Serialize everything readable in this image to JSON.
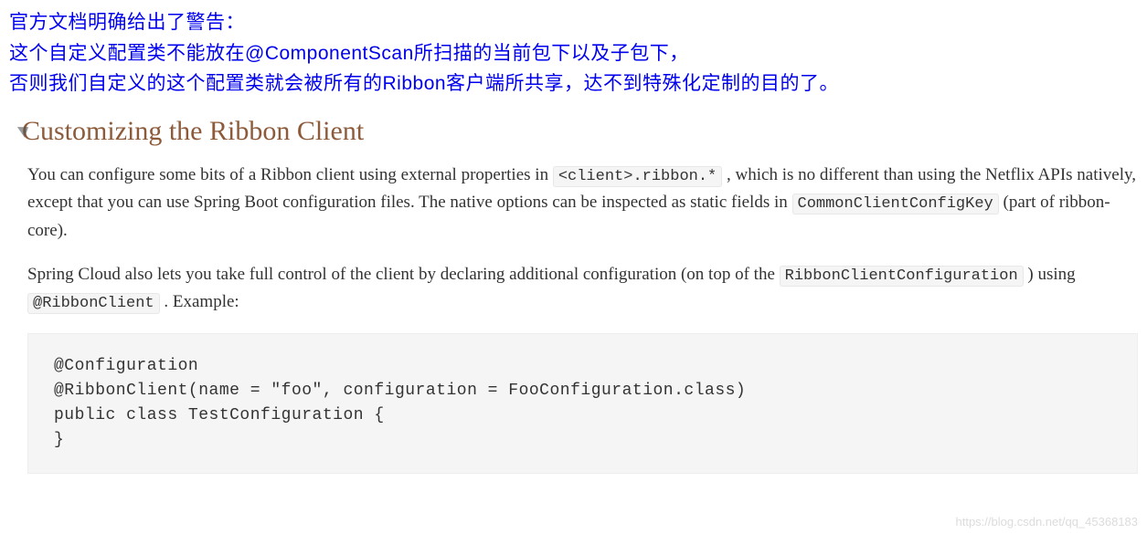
{
  "warning": {
    "line1": "官方文档明确给出了警告：",
    "line2": "这个自定义配置类不能放在@ComponentScan所扫描的当前包下以及子包下，",
    "line3": "否则我们自定义的这个配置类就会被所有的Ribbon客户端所共享，达不到特殊化定制的目的了。"
  },
  "heading": "Customizing the Ribbon Client",
  "para1": {
    "t1": "You can configure some bits of a Ribbon client using external properties in ",
    "c1": "<client>.ribbon.*",
    "t2": " , which is no different than using the Netflix APIs natively, except that you can use Spring Boot configuration files. The native options can be inspected as static fields in ",
    "c2": "CommonClientConfigKey",
    "t3": " (part of ribbon-core)."
  },
  "para2": {
    "t1": "Spring Cloud also lets you take full control of the client by declaring additional configuration (on top of the ",
    "c1": "RibbonClientConfiguration",
    "t2": " ) using ",
    "c2": "@RibbonClient",
    "t3": " . Example:"
  },
  "code": "@Configuration\n@RibbonClient(name = \"foo\", configuration = FooConfiguration.class)\npublic class TestConfiguration {\n}",
  "watermark": "https://blog.csdn.net/qq_45368183"
}
